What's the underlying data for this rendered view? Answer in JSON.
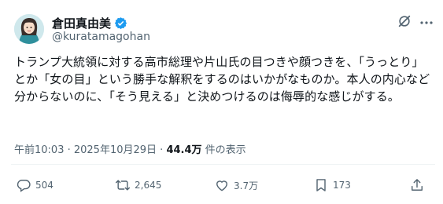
{
  "author": {
    "display_name": "倉田真由美",
    "handle": "@kuratamagohan"
  },
  "tweet": {
    "text": "トランプ大統領に対する高市総理や片山氏の目つきや顔つきを、「うっとり」とか「女の目」という勝手な解釈をするのはいかがなものか。本人の内心など分からないのに、「そう見える」と決めつけるのは侮辱的な感じがする。",
    "timestamp": "午前10:03 · 2025年10月29日 · ",
    "views_count": "44.4万",
    "views_label": " 件の表示"
  },
  "actions": {
    "replies": "504",
    "reposts": "2,645",
    "likes": "3.7万",
    "bookmarks": "173"
  },
  "colors": {
    "verified": "#1d9bf0",
    "muted": "#536471",
    "text": "#0f1419"
  },
  "icons": [
    "verified-badge-icon",
    "grok-icon",
    "more-icon",
    "reply-icon",
    "repost-icon",
    "like-icon",
    "bookmark-icon",
    "share-icon"
  ]
}
